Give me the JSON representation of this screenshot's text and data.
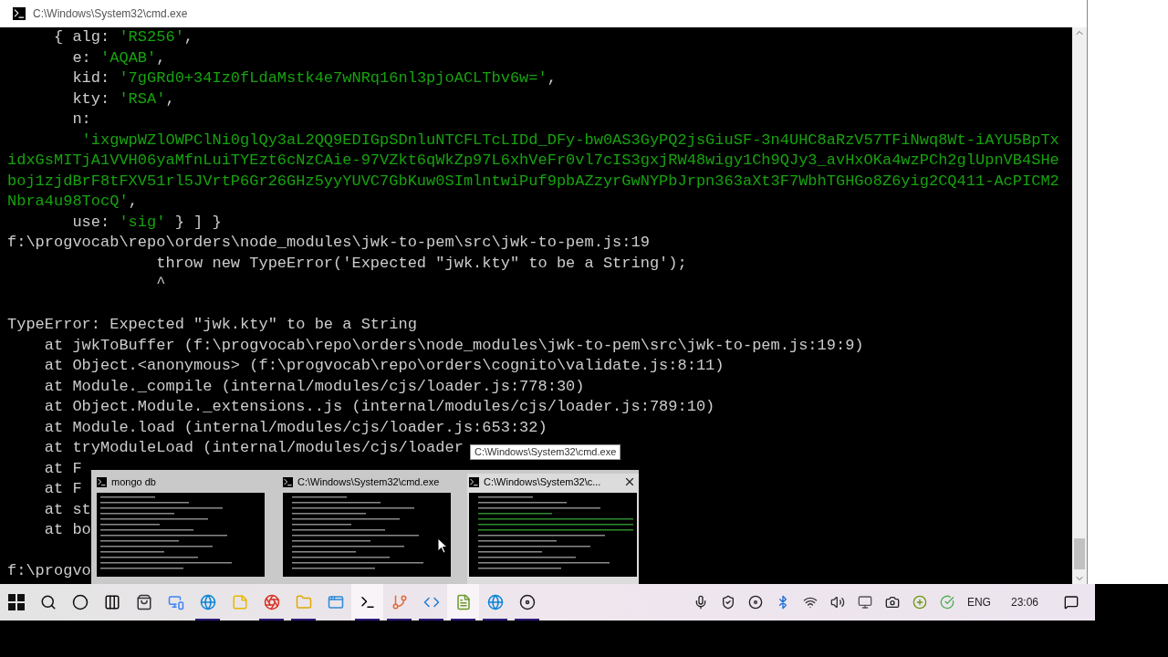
{
  "window": {
    "title": "C:\\Windows\\System32\\cmd.exe"
  },
  "console": {
    "lines": [
      {
        "kind": "text",
        "parts": [
          {
            "kind": "plain",
            "text": "     { alg: "
          },
          {
            "kind": "string",
            "text": "'RS256'"
          },
          {
            "kind": "plain",
            "text": ","
          }
        ]
      },
      {
        "kind": "text",
        "parts": [
          {
            "kind": "plain",
            "text": "       e: "
          },
          {
            "kind": "string",
            "text": "'AQAB'"
          },
          {
            "kind": "plain",
            "text": ","
          }
        ]
      },
      {
        "kind": "text",
        "parts": [
          {
            "kind": "plain",
            "text": "       kid: "
          },
          {
            "kind": "string",
            "text": "'7gGRd0+34Iz0fLdaMstk4e7wNRq16nl3pjoACLTbv6w='"
          },
          {
            "kind": "plain",
            "text": ","
          }
        ]
      },
      {
        "kind": "text",
        "parts": [
          {
            "kind": "plain",
            "text": "       kty: "
          },
          {
            "kind": "string",
            "text": "'RSA'"
          },
          {
            "kind": "plain",
            "text": ","
          }
        ]
      },
      {
        "kind": "text",
        "parts": [
          {
            "kind": "plain",
            "text": "       n:"
          }
        ]
      },
      {
        "kind": "text",
        "parts": [
          {
            "kind": "string",
            "text": "        'ixgwpWZlOWPClNi0glQy3aL2QQ9EDIGpSDnluNTCFLTcLIDd_DFy-bw0AS3GyPQ2jsGiuSF-3n4UHC8aRzV57TFiNwq8Wt-iAYU5BpTx"
          }
        ]
      },
      {
        "kind": "text",
        "parts": [
          {
            "kind": "string",
            "text": "idxGsMITjA1VVH06yaMfnLuiTYEzt6cNzCAie-97VZkt6qWkZp97L6xhVeFr0vl7cIS3gxjRW48wigy1Ch9QJy3_avHxOKa4wzPCh2glUpnVB4SHe"
          }
        ]
      },
      {
        "kind": "text",
        "parts": [
          {
            "kind": "string",
            "text": "boj1zjdBrF8tFXV51rl5JVrtP6Gr26GHz5yyYUVC7GbKuw0SImlntwiPuf9pbAZzyrGwNYPbJrpn363aXt3F7WbhTGHGo8Z6yig2CQ411-AcPICM2"
          }
        ]
      },
      {
        "kind": "text",
        "parts": [
          {
            "kind": "string",
            "text": "Nbra4u98TocQ'"
          },
          {
            "kind": "plain",
            "text": ","
          }
        ]
      },
      {
        "kind": "text",
        "parts": [
          {
            "kind": "plain",
            "text": "       use: "
          },
          {
            "kind": "string",
            "text": "'sig'"
          },
          {
            "kind": "plain",
            "text": " } ] }"
          }
        ]
      },
      {
        "kind": "text",
        "parts": [
          {
            "kind": "plain",
            "text": "f:\\progvocab\\repo\\orders\\node_modules\\jwk-to-pem\\src\\jwk-to-pem.js:19"
          }
        ]
      },
      {
        "kind": "text",
        "parts": [
          {
            "kind": "plain",
            "text": "                throw new TypeError('Expected \"jwk.kty\" to be a String');"
          }
        ]
      },
      {
        "kind": "text",
        "parts": [
          {
            "kind": "plain",
            "text": "                ^"
          }
        ]
      },
      {
        "kind": "blank"
      },
      {
        "kind": "text",
        "parts": [
          {
            "kind": "plain",
            "text": "TypeError: Expected \"jwk.kty\" to be a String"
          }
        ]
      },
      {
        "kind": "text",
        "parts": [
          {
            "kind": "plain",
            "text": "    at jwkToBuffer (f:\\progvocab\\repo\\orders\\node_modules\\jwk-to-pem\\src\\jwk-to-pem.js:19:9)"
          }
        ]
      },
      {
        "kind": "text",
        "parts": [
          {
            "kind": "plain",
            "text": "    at Object.<anonymous> (f:\\progvocab\\repo\\orders\\cognito\\validate.js:8:11)"
          }
        ]
      },
      {
        "kind": "text",
        "parts": [
          {
            "kind": "plain",
            "text": "    at Module._compile (internal/modules/cjs/loader.js:778:30)"
          }
        ]
      },
      {
        "kind": "text",
        "parts": [
          {
            "kind": "plain",
            "text": "    at Object.Module._extensions..js (internal/modules/cjs/loader.js:789:10)"
          }
        ]
      },
      {
        "kind": "text",
        "parts": [
          {
            "kind": "plain",
            "text": "    at Module.load (internal/modules/cjs/loader.js:653:32)"
          }
        ]
      },
      {
        "kind": "text",
        "parts": [
          {
            "kind": "plain",
            "text": "    at tryModuleLoad (internal/modules/cjs/loader"
          }
        ]
      },
      {
        "kind": "text",
        "parts": [
          {
            "kind": "plain",
            "text": "    at F"
          }
        ]
      },
      {
        "kind": "text",
        "parts": [
          {
            "kind": "plain",
            "text": "    at F"
          }
        ]
      },
      {
        "kind": "text",
        "parts": [
          {
            "kind": "plain",
            "text": "    at st"
          }
        ]
      },
      {
        "kind": "text",
        "parts": [
          {
            "kind": "plain",
            "text": "    at bo"
          }
        ]
      },
      {
        "kind": "blank"
      },
      {
        "kind": "text",
        "parts": [
          {
            "kind": "plain",
            "text": "f:\\progvo"
          }
        ]
      }
    ]
  },
  "tooltip": "C:\\Windows\\System32\\cmd.exe",
  "thumbnails": [
    {
      "title": "mongo db",
      "selected": false
    },
    {
      "title": "C:\\Windows\\System32\\cmd.exe",
      "selected": false
    },
    {
      "title": "C:\\Windows\\System32\\c...",
      "selected": true
    }
  ],
  "taskbar": {
    "apps": [
      {
        "kind": "start",
        "running": false,
        "selected": false
      },
      {
        "kind": "search",
        "running": false,
        "selected": false
      },
      {
        "kind": "cortana",
        "running": false,
        "selected": false
      },
      {
        "kind": "taskview",
        "running": false,
        "selected": false
      },
      {
        "kind": "store",
        "running": false,
        "selected": false
      },
      {
        "kind": "remote",
        "running": false,
        "selected": false
      },
      {
        "kind": "edge",
        "running": true,
        "selected": false
      },
      {
        "kind": "sticky",
        "running": false,
        "selected": false
      },
      {
        "kind": "chrome",
        "running": true,
        "selected": false
      },
      {
        "kind": "folder",
        "running": true,
        "selected": false
      },
      {
        "kind": "window",
        "running": false,
        "selected": false
      },
      {
        "kind": "terminal",
        "running": true,
        "selected": true
      },
      {
        "kind": "git",
        "running": true,
        "selected": false
      },
      {
        "kind": "code",
        "running": true,
        "selected": false
      },
      {
        "kind": "notepad",
        "running": true,
        "selected": true
      },
      {
        "kind": "edge",
        "running": true,
        "selected": false
      },
      {
        "kind": "obs",
        "running": true,
        "selected": false
      }
    ],
    "tray": {
      "language": "ENG",
      "time": "23:06"
    }
  }
}
